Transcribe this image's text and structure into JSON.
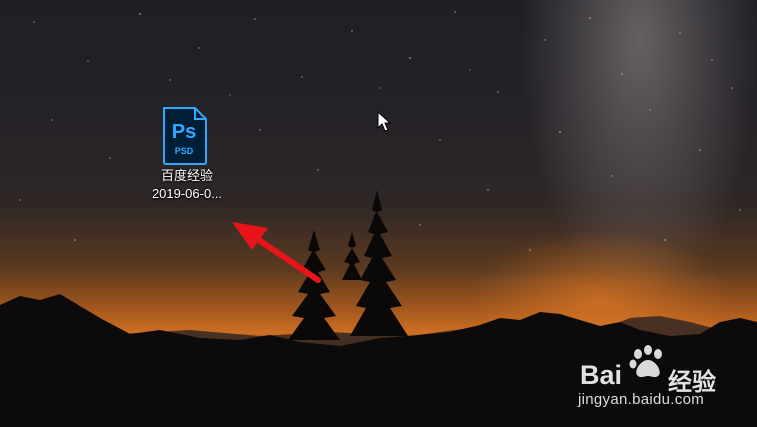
{
  "desktop": {
    "icons": [
      {
        "badge": "Ps",
        "subtype": "PSD",
        "name_line1": "百度经验",
        "name_line2": "2019-06-0...",
        "icon": "photoshop-psd-file-icon"
      }
    ]
  },
  "watermark": {
    "brand": "Bai",
    "brand_suffix": "经验",
    "url": "jingyan.baidu.com",
    "icon": "baidu-paw-icon"
  },
  "cursor": {
    "icon": "mouse-pointer-icon"
  },
  "colors": {
    "ps_frame": "#31a8ff",
    "ps_fill": "#001e36",
    "arrow": "#e8141a"
  }
}
